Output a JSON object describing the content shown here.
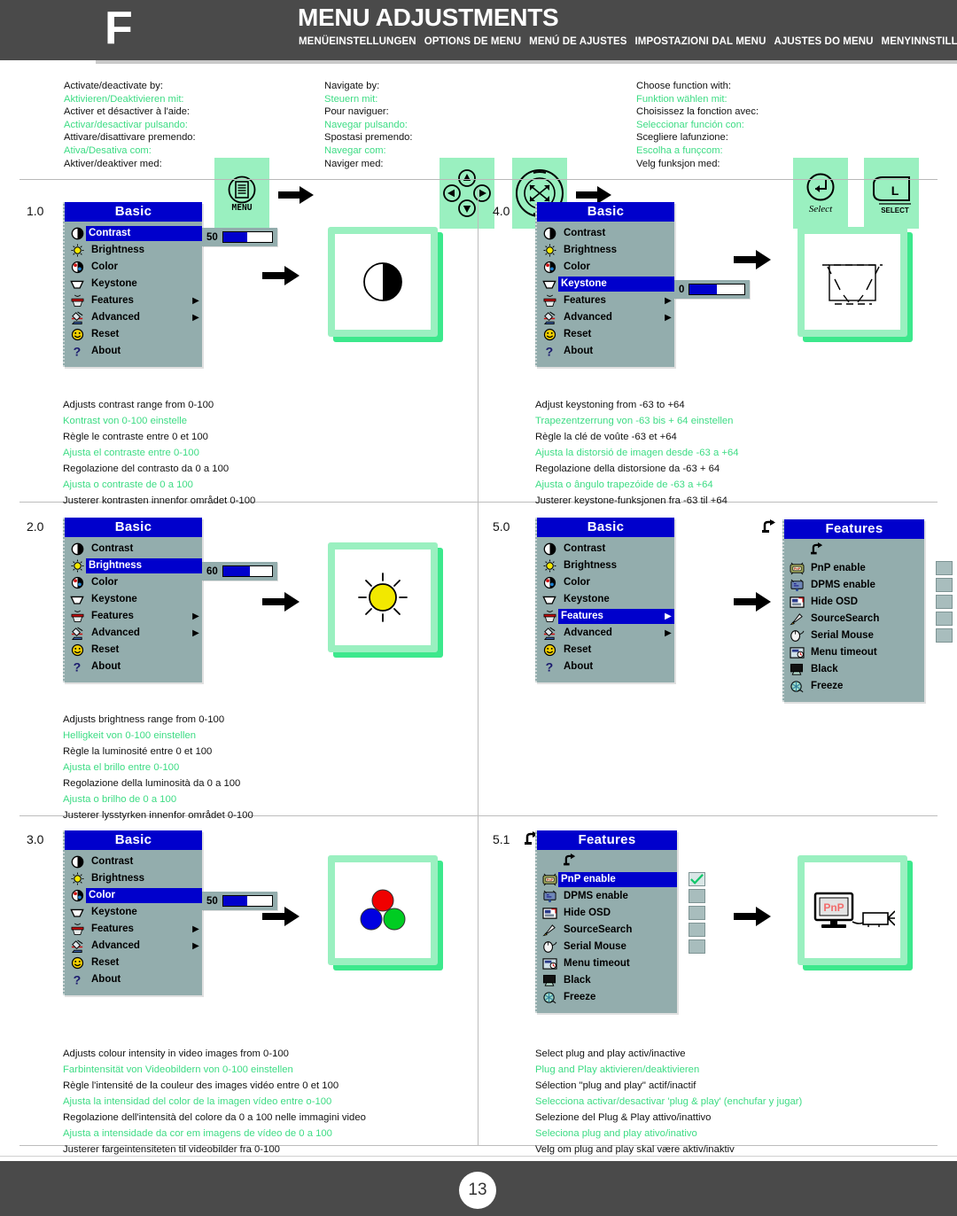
{
  "header": {
    "letter": "F",
    "title": "MENU ADJUSTMENTS",
    "subtitles": [
      "MENÜEINSTELLUNGEN",
      "OPTIONS DE MENU",
      "MENÚ DE AJUSTES",
      "IMPOSTAZIONI DAL MENU",
      "AJUSTES DO MENU",
      "MENYINNSTILLINGER"
    ]
  },
  "instructions": {
    "activate": {
      "lines": [
        {
          "t": "Activate/deactivate by:",
          "g": false
        },
        {
          "t": "Aktivieren/Deaktivieren mit:",
          "g": true
        },
        {
          "t": "Activer et désactiver à l'aide:",
          "g": false
        },
        {
          "t": "Activar/desactivar pulsando:",
          "g": true
        },
        {
          "t": "Attivare/disattivare premendo:",
          "g": false
        },
        {
          "t": "Ativa/Desativa com:",
          "g": true
        },
        {
          "t": "Aktiver/deaktiver med:",
          "g": false
        }
      ],
      "button_label": "MENU",
      "button_icon": "menu-document-icon"
    },
    "navigate": {
      "lines": [
        {
          "t": "Navigate by:",
          "g": false
        },
        {
          "t": "Steuern mit:",
          "g": true
        },
        {
          "t": "Pour naviguer:",
          "g": false
        },
        {
          "t": "Navegar pulsando:",
          "g": true
        },
        {
          "t": "Spostasi premendo:",
          "g": false
        },
        {
          "t": "Navegar com:",
          "g": true
        },
        {
          "t": "Naviger med:",
          "g": false
        }
      ],
      "button_icon_1": "dpad-arrows-icon",
      "button_icon_2": "joystick-icon"
    },
    "choose": {
      "lines": [
        {
          "t": "Choose function with:",
          "g": false
        },
        {
          "t": "Funktion wählen mit:",
          "g": true
        },
        {
          "t": "Choisissez la fonction avec:",
          "g": false
        },
        {
          "t": "Seleccionar función con:",
          "g": true
        },
        {
          "t": "Scegliere lafunzione:",
          "g": false
        },
        {
          "t": "Escolha a funçcom:",
          "g": true
        },
        {
          "t": "Velg funksjon med:",
          "g": false
        }
      ],
      "select_caption": "Select",
      "select_key_letter": "L",
      "select_key_caption": "SELECT"
    }
  },
  "osd": {
    "basic_title": "Basic",
    "features_title": "Features",
    "basic_items": [
      {
        "label": "Contrast",
        "icon": "contrast-icon",
        "submenu": false
      },
      {
        "label": "Brightness",
        "icon": "brightness-sun-icon",
        "submenu": false
      },
      {
        "label": "Color",
        "icon": "color-wheel-icon",
        "submenu": false
      },
      {
        "label": "Keystone",
        "icon": "keystone-trapezoid-icon",
        "submenu": false
      },
      {
        "label": "Features",
        "icon": "features-paint-icon",
        "submenu": true
      },
      {
        "label": "Advanced",
        "icon": "advanced-microscope-icon",
        "submenu": true
      },
      {
        "label": "Reset",
        "icon": "reset-smiley-icon",
        "submenu": false
      },
      {
        "label": "About",
        "icon": "about-question-icon",
        "submenu": false
      }
    ],
    "features_items": [
      {
        "label": "PnP enable",
        "icon": "pnp-icon",
        "checkbox": true
      },
      {
        "label": "DPMS enable",
        "icon": "dpms-icon",
        "checkbox": true
      },
      {
        "label": "Hide OSD",
        "icon": "hide-osd-icon",
        "checkbox": true
      },
      {
        "label": "SourceSearch",
        "icon": "source-search-icon",
        "checkbox": true
      },
      {
        "label": "Serial Mouse",
        "icon": "serial-mouse-icon",
        "checkbox": true
      },
      {
        "label": "Menu timeout",
        "icon": "menu-timeout-icon",
        "checkbox": false
      },
      {
        "label": "Black",
        "icon": "black-icon",
        "checkbox": false
      },
      {
        "label": "Freeze",
        "icon": "freeze-icon",
        "checkbox": false
      }
    ]
  },
  "steps": [
    {
      "number": "1.0",
      "selected": "Contrast",
      "slider_value": "50",
      "slider_percent": 50,
      "illustration": "contrast-half-circle",
      "caption": [
        {
          "t": "Adjusts contrast range from 0-100",
          "g": false
        },
        {
          "t": "Kontrast von 0-100 einstelle",
          "g": true
        },
        {
          "t": "Règle le contraste entre 0 et 100",
          "g": false
        },
        {
          "t": "Ajusta el contraste entre 0-100",
          "g": true
        },
        {
          "t": "Regolazione del contrasto da 0 a 100",
          "g": false
        },
        {
          "t": "Ajusta o contraste de 0 a 100",
          "g": true
        },
        {
          "t": "Justerer kontrasten innenfor området 0-100",
          "g": false
        }
      ]
    },
    {
      "number": "2.0",
      "selected": "Brightness",
      "slider_value": "60",
      "slider_percent": 55,
      "illustration": "brightness-sun",
      "caption": [
        {
          "t": "Adjusts brightness range from 0-100",
          "g": false
        },
        {
          "t": "Helligkeit von 0-100 einstellen",
          "g": true
        },
        {
          "t": "Règle la luminosité entre 0 et 100",
          "g": false
        },
        {
          "t": "Ajusta el brillo entre 0-100",
          "g": true
        },
        {
          "t": "Regolazione della luminosità da 0 a 100",
          "g": false
        },
        {
          "t": "Ajusta o brilho de 0 a 100",
          "g": true
        },
        {
          "t": "Justerer lysstyrken innenfor området 0-100",
          "g": false
        }
      ]
    },
    {
      "number": "3.0",
      "selected": "Color",
      "slider_value": "50",
      "slider_percent": 50,
      "illustration": "rgb-dots",
      "caption": [
        {
          "t": "Adjusts colour intensity in video images from 0-100",
          "g": false
        },
        {
          "t": "Farbintensität von Videobildern von 0-100 einstellen",
          "g": true
        },
        {
          "t": "Règle l'intensité de la couleur des images vidéo entre 0 et 100",
          "g": false
        },
        {
          "t": "Ajusta la intensidad del color de la imagen vídeo entre o-100",
          "g": true
        },
        {
          "t": "Regolazione dell'intensità del colore da 0 a 100 nelle immagini video",
          "g": false
        },
        {
          "t": "Ajusta a intensidade da cor em imagens de vídeo de 0 a 100",
          "g": true
        },
        {
          "t": "Justerer fargeintensiteten til videobilder fra 0-100",
          "g": false
        }
      ]
    },
    {
      "number": "4.0",
      "selected": "Keystone",
      "slider_value": "0",
      "slider_percent": 50,
      "illustration": "keystone-trapezoid",
      "caption": [
        {
          "t": "Adjust keystoning from -63 to +64",
          "g": false
        },
        {
          "t": "Trapezentzerrung von -63 bis + 64 einstellen",
          "g": true
        },
        {
          "t": "Règle la clé de voûte -63 et +64",
          "g": false
        },
        {
          "t": "Ajusta la distorsió de imagen desde -63 a +64",
          "g": true
        },
        {
          "t": "Regolazione della distorsione da -63 + 64",
          "g": false
        },
        {
          "t": "Ajusta o ângulo trapezóide de -63 a +64",
          "g": true
        },
        {
          "t": "Justerer keystone-funksjonen fra -63 til +64",
          "g": false
        }
      ]
    },
    {
      "number": "5.0",
      "selected": "Features",
      "slider_value": null,
      "illustration": "features-submenu",
      "caption": []
    },
    {
      "number": "5.1",
      "selected": "PnP enable",
      "checked": "PnP enable",
      "illustration": "pnp-monitor",
      "caption": [
        {
          "t": "Select plug and play activ/inactive",
          "g": false
        },
        {
          "t": "Plug and Play aktivieren/deaktivieren",
          "g": true
        },
        {
          "t": "Sélection \"plug and play\" actif/inactif",
          "g": false
        },
        {
          "t": "Selecciona activar/desactivar 'plug & play' (enchufar y jugar)",
          "g": true
        },
        {
          "t": "Selezione del Plug & Play attivo/inattivo",
          "g": false
        },
        {
          "t": "Seleciona plug and play ativo/inativo",
          "g": true
        },
        {
          "t": "Velg om plug and play skal være aktiv/inaktiv",
          "g": false
        }
      ]
    }
  ],
  "footer": {
    "page": "13"
  },
  "colors": {
    "header_bg": "#4a4a4a",
    "accent_green": "#3ddc84",
    "osd_bg": "#93adad",
    "osd_title_bg": "#0000cc",
    "card_green": "#9af0c0",
    "card_shadow_green": "#3ce88c"
  }
}
